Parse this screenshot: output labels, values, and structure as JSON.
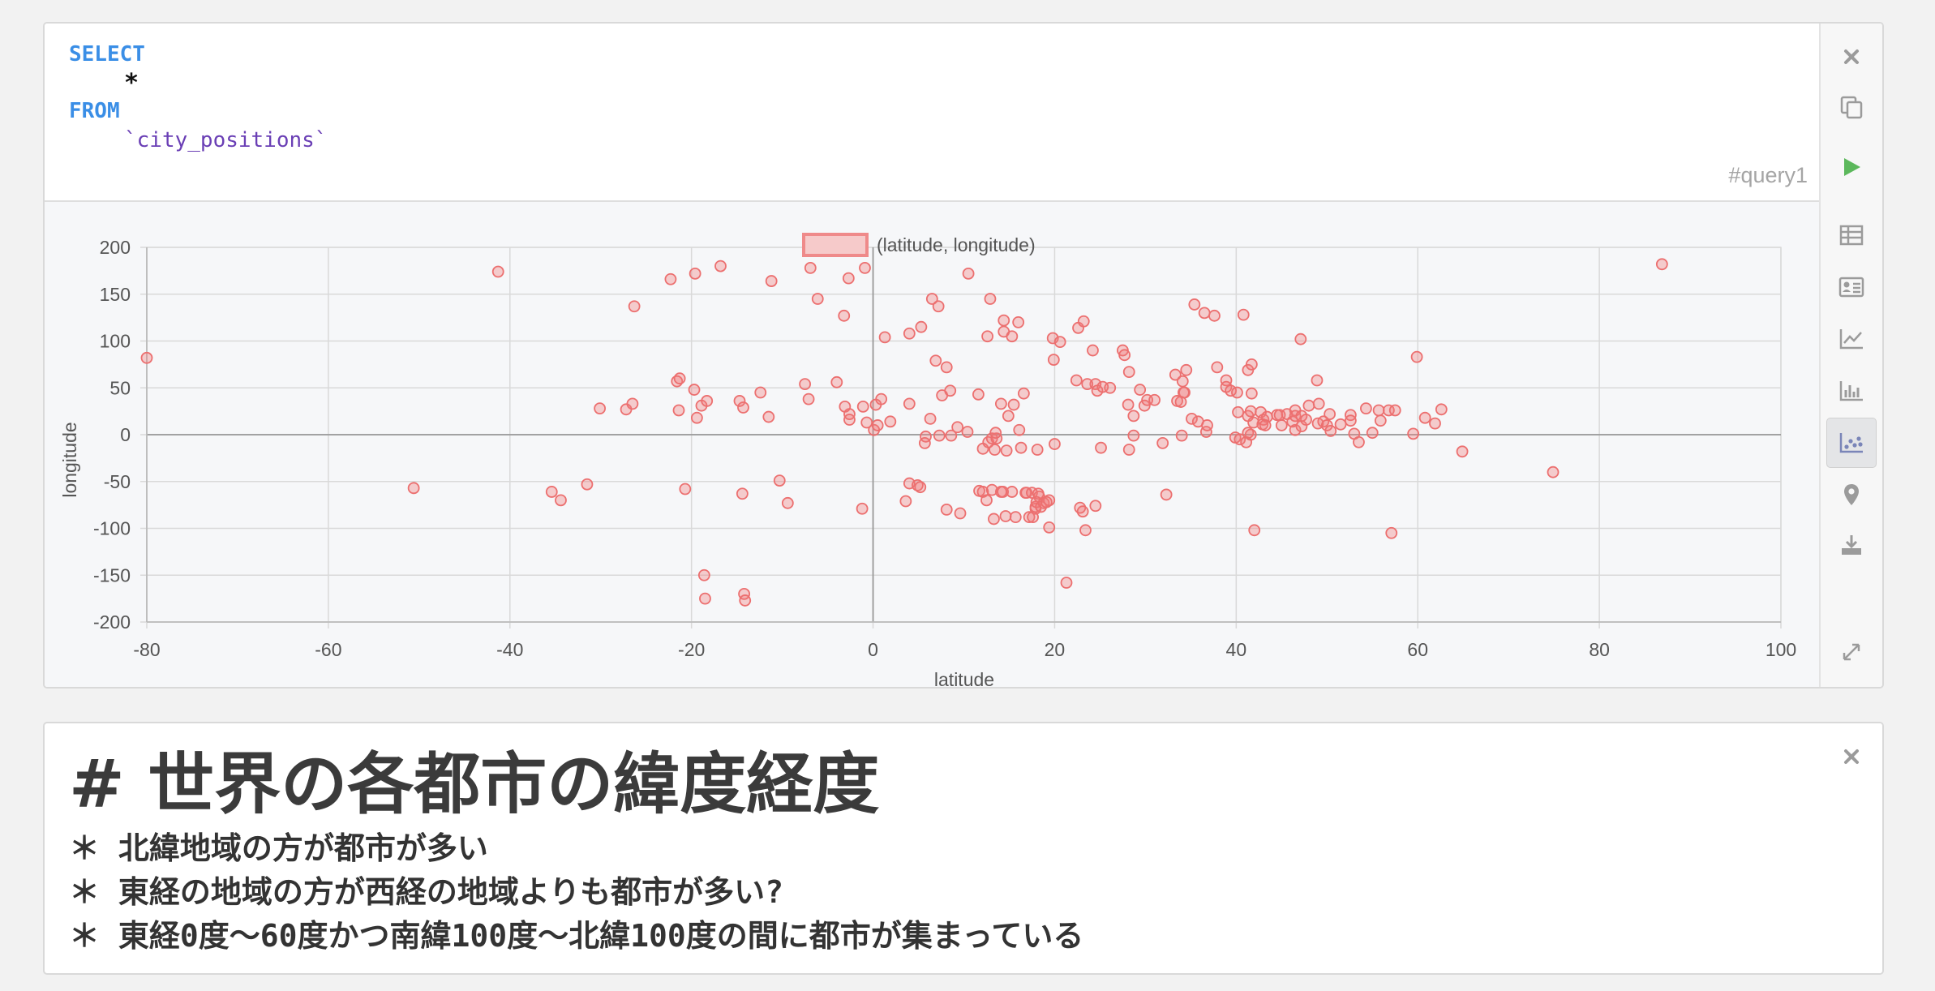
{
  "query": {
    "code": {
      "select_kw": "SELECT",
      "star": "*",
      "from_kw": "FROM",
      "table": "`city_positions`"
    },
    "tag": "#query1",
    "toolbar": [
      {
        "name": "close-icon"
      },
      {
        "name": "copy-icon"
      },
      {
        "name": "run-icon"
      },
      {
        "name": "table-view-icon"
      },
      {
        "name": "record-view-icon"
      },
      {
        "name": "line-chart-icon"
      },
      {
        "name": "bar-chart-icon"
      },
      {
        "name": "scatter-chart-icon",
        "active": true
      },
      {
        "name": "map-pin-icon"
      },
      {
        "name": "download-icon"
      },
      {
        "name": "expand-icon"
      }
    ]
  },
  "colors": {
    "keyword": "#3a8ee6",
    "table_name": "#6a3fb5",
    "point_fill": "rgba(240,120,120,0.35)",
    "point_stroke": "#ec6f6f",
    "run_button": "#5cb85c"
  },
  "chart_data": {
    "type": "scatter",
    "legend": "(latitude, longitude)",
    "legend_position": "top",
    "xlabel": "latitude",
    "ylabel": "longitude",
    "xlim": [
      -80,
      100
    ],
    "ylim": [
      -200,
      200
    ],
    "xticks": [
      "-80",
      "-60",
      "-40",
      "-20",
      "0",
      "20",
      "40",
      "60",
      "80",
      "100"
    ],
    "yticks": [
      "200",
      "150",
      "100",
      "50",
      "0",
      "-50",
      "-100",
      "-150",
      "-200"
    ],
    "grid": true,
    "points": [
      [
        -80,
        82
      ],
      [
        -50.6,
        -57
      ],
      [
        -41.3,
        174
      ],
      [
        -35.4,
        -61
      ],
      [
        -34.4,
        -70
      ],
      [
        -31.5,
        -53
      ],
      [
        -30.1,
        28
      ],
      [
        -27.2,
        27
      ],
      [
        -26.5,
        33
      ],
      [
        -26.3,
        137
      ],
      [
        -22.3,
        166
      ],
      [
        -21.6,
        57
      ],
      [
        -21.3,
        60
      ],
      [
        -21.4,
        26
      ],
      [
        -20.7,
        -58
      ],
      [
        -19.7,
        48
      ],
      [
        -19.6,
        172
      ],
      [
        -19.4,
        18
      ],
      [
        -18.6,
        -150
      ],
      [
        -18.5,
        -175
      ],
      [
        -18.9,
        31
      ],
      [
        -18.3,
        36
      ],
      [
        -16.8,
        180
      ],
      [
        -14.7,
        36
      ],
      [
        -14.3,
        29
      ],
      [
        -14.4,
        -63
      ],
      [
        -14.2,
        -170
      ],
      [
        -14.1,
        -177
      ],
      [
        -12.4,
        45
      ],
      [
        -11.5,
        19
      ],
      [
        -11.2,
        164
      ],
      [
        -10.3,
        -49
      ],
      [
        -9.4,
        -73
      ],
      [
        -7.5,
        54
      ],
      [
        -7.1,
        38
      ],
      [
        -6.9,
        178
      ],
      [
        -6.1,
        145
      ],
      [
        -4,
        56
      ],
      [
        -3.2,
        127
      ],
      [
        -3.1,
        30
      ],
      [
        -2.7,
        167
      ],
      [
        -2.6,
        22
      ],
      [
        -2.6,
        16
      ],
      [
        -1.1,
        30
      ],
      [
        -0.9,
        178
      ],
      [
        -1.2,
        -79
      ],
      [
        -0.7,
        13
      ],
      [
        0.1,
        5
      ],
      [
        0.3,
        32
      ],
      [
        0.5,
        10
      ],
      [
        1.3,
        104
      ],
      [
        0.9,
        38
      ],
      [
        1.9,
        14
      ],
      [
        4,
        -52
      ],
      [
        4,
        33
      ],
      [
        3.6,
        -71
      ],
      [
        4.9,
        -54
      ],
      [
        4,
        108
      ],
      [
        5.8,
        -2
      ],
      [
        5.3,
        115
      ],
      [
        5.2,
        -56
      ],
      [
        5.7,
        -9
      ],
      [
        6.3,
        17
      ],
      [
        6.5,
        145
      ],
      [
        7.2,
        137
      ],
      [
        6.9,
        79
      ],
      [
        7.3,
        -1
      ],
      [
        7.6,
        42
      ],
      [
        8.1,
        -80
      ],
      [
        8.6,
        -1
      ],
      [
        8.1,
        72
      ],
      [
        8.5,
        47
      ],
      [
        9.6,
        -84
      ],
      [
        9.3,
        8
      ],
      [
        10.4,
        3
      ],
      [
        10.5,
        172
      ],
      [
        11.7,
        -60
      ],
      [
        11.6,
        43
      ],
      [
        12.1,
        -61
      ],
      [
        12.1,
        -15
      ],
      [
        12.5,
        -70
      ],
      [
        12.6,
        105
      ],
      [
        12.7,
        -8
      ],
      [
        12.9,
        145
      ],
      [
        13.1,
        -4
      ],
      [
        13.1,
        -59
      ],
      [
        13.4,
        -16
      ],
      [
        13.3,
        -90
      ],
      [
        13.6,
        -4
      ],
      [
        13.5,
        2
      ],
      [
        14.1,
        -61
      ],
      [
        14.4,
        110
      ],
      [
        14.6,
        -87
      ],
      [
        14.4,
        122
      ],
      [
        14.7,
        -17
      ],
      [
        14.3,
        -61
      ],
      [
        14.1,
        33
      ],
      [
        14.9,
        20
      ],
      [
        15.3,
        105
      ],
      [
        15.5,
        32
      ],
      [
        15.3,
        -61
      ],
      [
        15.7,
        -88
      ],
      [
        16,
        120
      ],
      [
        16.1,
        5
      ],
      [
        16.6,
        44
      ],
      [
        16.8,
        -62
      ],
      [
        16.3,
        -14
      ],
      [
        16.9,
        -62
      ],
      [
        17.2,
        -88
      ],
      [
        17.6,
        -88
      ],
      [
        17.9,
        -79
      ],
      [
        17.5,
        -62
      ],
      [
        17.9,
        -77
      ],
      [
        18.3,
        -66
      ],
      [
        18.2,
        -63
      ],
      [
        18,
        -72
      ],
      [
        18.5,
        -77
      ],
      [
        18.1,
        -16
      ],
      [
        18.8,
        -73
      ],
      [
        19.4,
        -70
      ],
      [
        19.4,
        -99
      ],
      [
        19.1,
        -72
      ],
      [
        19.8,
        103
      ],
      [
        19.9,
        80
      ],
      [
        20,
        -10
      ],
      [
        20.6,
        99
      ],
      [
        21.3,
        -158
      ],
      [
        22.6,
        114
      ],
      [
        22.4,
        58
      ],
      [
        22.8,
        -78
      ],
      [
        23.2,
        121
      ],
      [
        23.1,
        -82
      ],
      [
        23.6,
        54
      ],
      [
        23.4,
        -102
      ],
      [
        24.2,
        90
      ],
      [
        24.5,
        54
      ],
      [
        24.7,
        47
      ],
      [
        24.5,
        -76
      ],
      [
        25.1,
        -14
      ],
      [
        25.3,
        51
      ],
      [
        26.1,
        50
      ],
      [
        27.5,
        90
      ],
      [
        27.7,
        85
      ],
      [
        28.2,
        67
      ],
      [
        28.1,
        32
      ],
      [
        28.2,
        -16
      ],
      [
        28.7,
        20
      ],
      [
        28.7,
        -1
      ],
      [
        29.4,
        48
      ],
      [
        29.9,
        31
      ],
      [
        30.2,
        37
      ],
      [
        31,
        37
      ],
      [
        31.9,
        -9
      ],
      [
        32.3,
        -64
      ],
      [
        33.3,
        64
      ],
      [
        33.5,
        36
      ],
      [
        33.9,
        35
      ],
      [
        34,
        -1
      ],
      [
        34.1,
        57
      ],
      [
        34.5,
        69
      ],
      [
        34.3,
        45
      ],
      [
        34.2,
        45
      ],
      [
        35.1,
        17
      ],
      [
        35.4,
        139
      ],
      [
        35.8,
        14
      ],
      [
        36.5,
        130
      ],
      [
        36.7,
        3
      ],
      [
        36.8,
        10
      ],
      [
        37.6,
        127
      ],
      [
        37.9,
        72
      ],
      [
        38.9,
        58
      ],
      [
        38.9,
        51
      ],
      [
        39.4,
        47
      ],
      [
        39.9,
        -3
      ],
      [
        40.1,
        45
      ],
      [
        40.4,
        -5
      ],
      [
        40.2,
        24
      ],
      [
        40.8,
        128
      ],
      [
        41.1,
        -8
      ],
      [
        41.3,
        20
      ],
      [
        41.6,
        0
      ],
      [
        41.6,
        25
      ],
      [
        41.3,
        69
      ],
      [
        41.7,
        44
      ],
      [
        41.7,
        75
      ],
      [
        41.3,
        2
      ],
      [
        41.9,
        13
      ],
      [
        42,
        -102
      ],
      [
        42.7,
        24
      ],
      [
        43,
        16
      ],
      [
        42.9,
        11
      ],
      [
        43.4,
        19
      ],
      [
        43.2,
        10
      ],
      [
        44.5,
        21
      ],
      [
        44.8,
        21
      ],
      [
        45,
        10
      ],
      [
        45.6,
        22
      ],
      [
        46.5,
        26
      ],
      [
        46.5,
        5
      ],
      [
        46.2,
        14
      ],
      [
        46.5,
        20
      ],
      [
        47.2,
        9
      ],
      [
        47.1,
        102
      ],
      [
        47.2,
        20
      ],
      [
        47.7,
        16
      ],
      [
        48,
        31
      ],
      [
        49,
        12
      ],
      [
        48.9,
        58
      ],
      [
        49.1,
        33
      ],
      [
        50.3,
        22
      ],
      [
        49.6,
        14
      ],
      [
        50,
        10
      ],
      [
        50.4,
        4
      ],
      [
        51.5,
        11
      ],
      [
        52.6,
        21
      ],
      [
        52.6,
        15
      ],
      [
        53,
        1
      ],
      [
        53.5,
        -8
      ],
      [
        54.3,
        28
      ],
      [
        55,
        2
      ],
      [
        55.7,
        26
      ],
      [
        55.9,
        15
      ],
      [
        56.8,
        26
      ],
      [
        57.1,
        -105
      ],
      [
        57.5,
        26
      ],
      [
        59.5,
        1
      ],
      [
        59.9,
        83
      ],
      [
        60.8,
        18
      ],
      [
        61.9,
        12
      ],
      [
        62.6,
        27
      ],
      [
        64.9,
        -18
      ],
      [
        74.9,
        -40
      ],
      [
        86.9,
        182
      ]
    ]
  },
  "markdown": {
    "title": "# 世界の各都市の緯度経度",
    "bullets": [
      "＊ 北緯地域の方が都市が多い",
      "＊ 東経の地域の方が西経の地域よりも都市が多い?",
      "＊ 東経0度〜60度かつ南緯100度〜北緯100度の間に都市が集まっている"
    ]
  }
}
